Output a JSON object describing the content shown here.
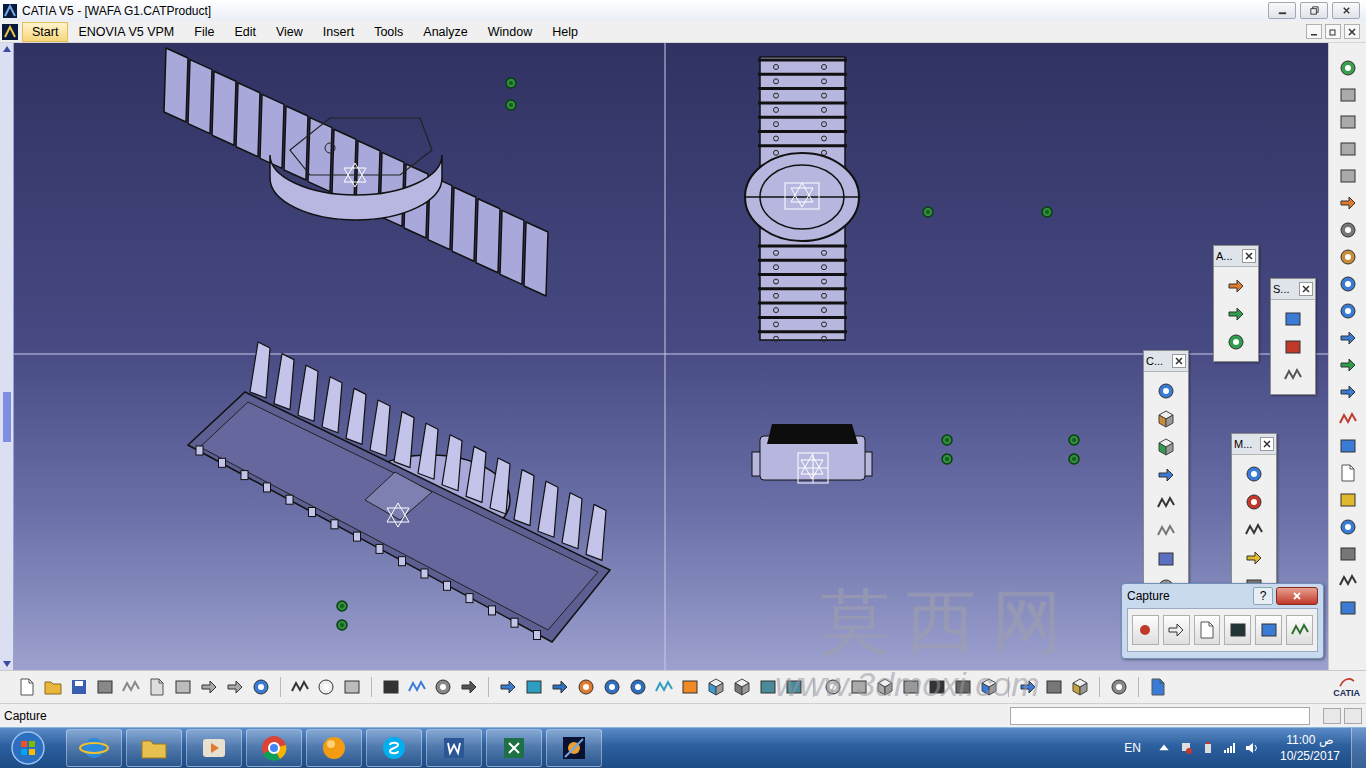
{
  "window": {
    "title": "CATIA V5 - [WAFA G1.CATProduct]"
  },
  "menu": [
    {
      "label": "Start",
      "selected": true
    },
    {
      "label": "ENOVIA V5 VPM",
      "selected": false
    },
    {
      "label": "File",
      "selected": false
    },
    {
      "label": "Edit",
      "selected": false
    },
    {
      "label": "View",
      "selected": false
    },
    {
      "label": "Insert",
      "selected": false
    },
    {
      "label": "Tools",
      "selected": false
    },
    {
      "label": "Analyze",
      "selected": false
    },
    {
      "label": "Window",
      "selected": false
    },
    {
      "label": "Help",
      "selected": false
    }
  ],
  "floating_toolbars": [
    {
      "title": "A..."
    },
    {
      "title": "S..."
    },
    {
      "title": "C..."
    },
    {
      "title": "M..."
    }
  ],
  "capture_toolbar": {
    "title": "Capture",
    "help": "?"
  },
  "status_bar": {
    "text": "Capture"
  },
  "logo": {
    "text": "CATIA"
  },
  "taskbar": {
    "language": "EN",
    "time": "11:00",
    "period": "ص",
    "date": "10/25/2017"
  },
  "watermark": {
    "brand": "莫西网",
    "url": "www.3dmoxi.com"
  }
}
